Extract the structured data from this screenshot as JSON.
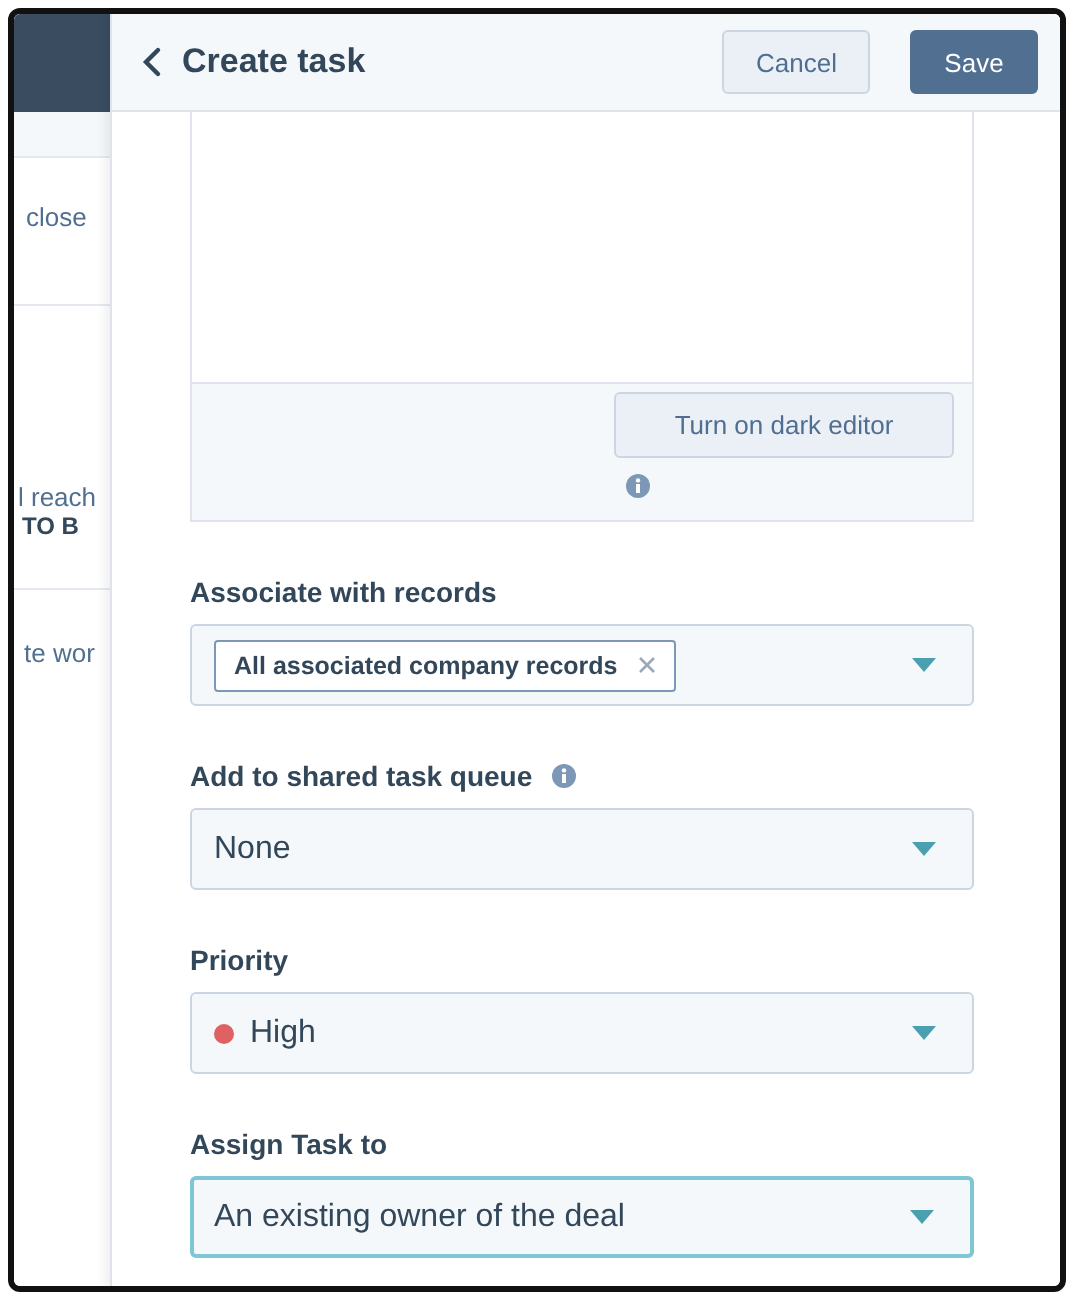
{
  "background_page": {
    "items": [
      {
        "text": "close",
        "bold": false
      },
      {
        "text": "l reach",
        "bold": false
      },
      {
        "text": "TO B",
        "bold": true
      },
      {
        "text": "te wor",
        "bold": false
      }
    ]
  },
  "panel": {
    "title": "Create task",
    "buttons": [
      {
        "label": "Cancel",
        "kind": "secondary"
      },
      {
        "label": "Save",
        "kind": "primary"
      }
    ]
  },
  "editor": {
    "button": "Turn on dark editor",
    "info": true
  },
  "fields": [
    {
      "label": "Associate with records",
      "kind": "tags",
      "tags": [
        "All associated company records"
      ],
      "focused": false
    },
    {
      "label": "Add to shared task queue",
      "kind": "select",
      "value": "None",
      "info": true,
      "focused": false
    },
    {
      "label": "Priority",
      "kind": "select",
      "value": "High",
      "color": "#e06161",
      "focused": false
    },
    {
      "label": "Assign Task to",
      "kind": "select",
      "value": "An existing owner of the deal",
      "focused": true
    }
  ]
}
